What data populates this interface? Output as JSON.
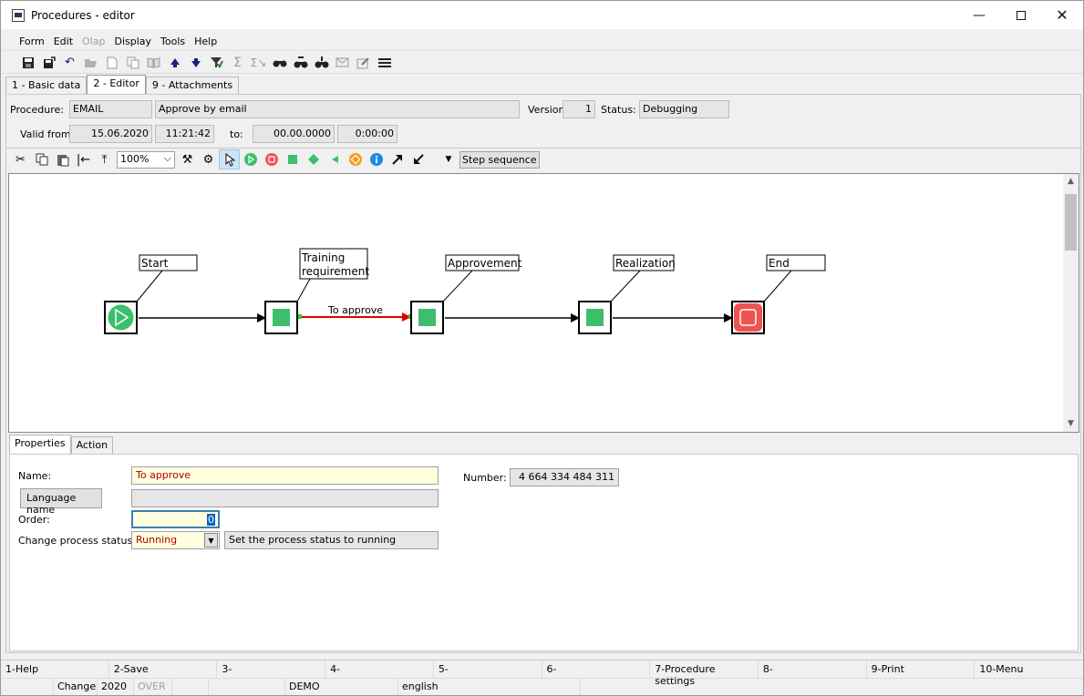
{
  "window": {
    "title": "Procedures - editor"
  },
  "menu": [
    "Form",
    "Edit",
    "Olap",
    "Display",
    "Tools",
    "Help"
  ],
  "menu_disabled": [
    "Olap"
  ],
  "toolbar1_icons": [
    "save-icon",
    "save-as-icon",
    "undo-icon",
    "open-icon",
    "new-icon",
    "copy-icon",
    "book-icon",
    "arrow-up-icon",
    "arrow-down-icon",
    "filter-icon",
    "sum-icon",
    "sum-group-icon",
    "find-icon",
    "find-next-icon",
    "find-all-icon",
    "mail-icon",
    "edit-icon",
    "menu-icon"
  ],
  "tabs": [
    {
      "label": "1 - Basic data",
      "active": false
    },
    {
      "label": "2 - Editor",
      "active": true
    },
    {
      "label": "9 - Attachments",
      "active": false
    }
  ],
  "header": {
    "procedure_label": "Procedure:",
    "procedure_code": "EMAIL",
    "procedure_name": "Approve by email",
    "version_label": "Version:",
    "version": "1",
    "status_label": "Status:",
    "status": "Debugging",
    "valid_from_label": "Valid from:",
    "valid_from_date": "15.06.2020",
    "valid_from_time": "11:21:42",
    "to_label": "to:",
    "to_date": "00.00.0000",
    "to_time": "0:00:00"
  },
  "editor_toolbar": {
    "zoom": "100%",
    "step_sequence": "Step sequence"
  },
  "diagram": {
    "nodes": [
      {
        "id": "start",
        "label": "Start",
        "kind": "start"
      },
      {
        "id": "training",
        "label_lines": [
          "Training",
          "requirement"
        ],
        "kind": "step"
      },
      {
        "id": "approvement",
        "label": "Approvement",
        "kind": "step"
      },
      {
        "id": "realization",
        "label": "Realization",
        "kind": "step"
      },
      {
        "id": "end",
        "label": "End",
        "kind": "end"
      }
    ],
    "edge_label": "To approve"
  },
  "properties_tabs": [
    {
      "label": "Properties",
      "active": true
    },
    {
      "label": "Action",
      "active": false
    }
  ],
  "properties": {
    "name_label": "Name:",
    "name_value": "To approve",
    "language_name_button": "Language name",
    "language_name_value": "",
    "order_label": "Order:",
    "order_value": "0",
    "change_status_label": "Change process status to",
    "change_status_value": "Running",
    "change_status_desc": "Set the process status to running",
    "number_label": "Number:",
    "number_value": "4 664 334 484 311"
  },
  "function_keys": [
    "1-Help",
    "2-Save",
    "3-",
    "4-",
    "5-",
    "6-",
    "7-Procedure settings",
    "8-",
    "9-Print",
    "10-Menu"
  ],
  "status_bar": {
    "mode": "Change",
    "year": "2020",
    "over": "OVER",
    "db": "DEMO",
    "language": "english"
  },
  "colors": {
    "step_green": "#3cbf6d",
    "end_red": "#ef5350",
    "edge_selected": "#e00000",
    "input_yellow": "#ffffe0"
  }
}
